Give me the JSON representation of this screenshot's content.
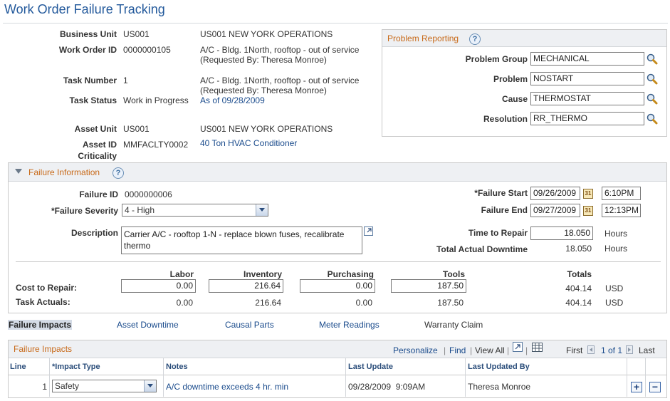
{
  "page_title": "Work Order Failure Tracking",
  "header": {
    "business_unit_label": "Business Unit",
    "business_unit": "US001",
    "business_unit_desc": "US001 NEW YORK OPERATIONS",
    "work_order_label": "Work Order ID",
    "work_order": "0000000105",
    "work_order_desc1": "A/C - Bldg. 1North, rooftop - out of service",
    "work_order_desc2": "(Requested By: Theresa Monroe)",
    "task_number_label": "Task Number",
    "task_number": "1",
    "task_desc1": "A/C - Bldg. 1North, rooftop - out of service",
    "task_desc2": "(Requested By: Theresa Monroe)",
    "task_status_label": "Task Status",
    "task_status": "Work in Progress",
    "task_status_link": "As of 09/28/2009",
    "asset_unit_label": "Asset Unit",
    "asset_unit": "US001",
    "asset_unit_desc": "US001 NEW YORK OPERATIONS",
    "asset_id_label1": "Asset ID",
    "asset_id_label2": "Criticality",
    "asset_id": "MMFACLTY0002",
    "asset_id_link": "40 Ton HVAC Conditioner"
  },
  "problem_reporting": {
    "title": "Problem Reporting",
    "help": "?",
    "problem_group_label": "Problem Group",
    "problem_group": "MECHANICAL",
    "problem_label": "Problem",
    "problem": "NOSTART",
    "cause_label": "Cause",
    "cause": "THERMOSTAT",
    "resolution_label": "Resolution",
    "resolution": "RR_THERMO"
  },
  "failure_info": {
    "title": "Failure Information",
    "help": "?",
    "failure_id_label": "Failure ID",
    "failure_id": "0000000006",
    "severity_label": "*Failure Severity",
    "severity": "4 - High",
    "description_label": "Description",
    "description1": "Carrier A/C - rooftop 1-N - replace blown fuses, recalibrate",
    "description2": "thermo",
    "start_label": "*Failure Start",
    "start_date": "09/26/2009",
    "start_time": "6:10PM",
    "end_label": "Failure End",
    "end_date": "09/27/2009",
    "end_time": "12:13PM",
    "time_to_repair_label": "Time to Repair",
    "time_to_repair": "18.050",
    "time_unit": "Hours",
    "downtime_label": "Total Actual Downtime",
    "downtime": "18.050",
    "downtime_unit": "Hours",
    "calendar_glyph": "31"
  },
  "costs": {
    "col_labor": "Labor",
    "col_inventory": "Inventory",
    "col_purchasing": "Purchasing",
    "col_tools": "Tools",
    "col_totals": "Totals",
    "row1_label": "Cost to Repair:",
    "row1": [
      "0.00",
      "216.64",
      "0.00",
      "187.50",
      "404.14",
      "USD"
    ],
    "row2_label": "Task Actuals:",
    "row2": [
      "0.00",
      "216.64",
      "0.00",
      "187.50",
      "404.14",
      "USD"
    ]
  },
  "tabs": {
    "active": "Failure Impacts",
    "asset_downtime": "Asset Downtime",
    "causal_parts": "Causal Parts",
    "meter_readings": "Meter Readings",
    "warranty_claim": "Warranty Claim"
  },
  "grid": {
    "title": "Failure Impacts",
    "personalize": "Personalize",
    "find": "Find",
    "view_all": "View All",
    "first": "First",
    "range": "1 of 1",
    "last": "Last",
    "columns": [
      "Line",
      "*Impact Type",
      "Notes",
      "Last Update",
      "Last Updated By"
    ],
    "rows": [
      {
        "line": "1",
        "impact_type": "Safety",
        "notes": "A/C downtime exceeds 4 hr. min",
        "last_update": "09/28/2009  9:09AM",
        "updated_by": "Theresa Monroe"
      }
    ],
    "add": "+",
    "remove": "−"
  },
  "icons": [
    "help-icon",
    "lookup-icon",
    "calendar-icon",
    "dropdown-arrow-icon",
    "expand-icon",
    "collapse-triangle-icon",
    "download-icon",
    "add-row-icon",
    "delete-row-icon"
  ]
}
